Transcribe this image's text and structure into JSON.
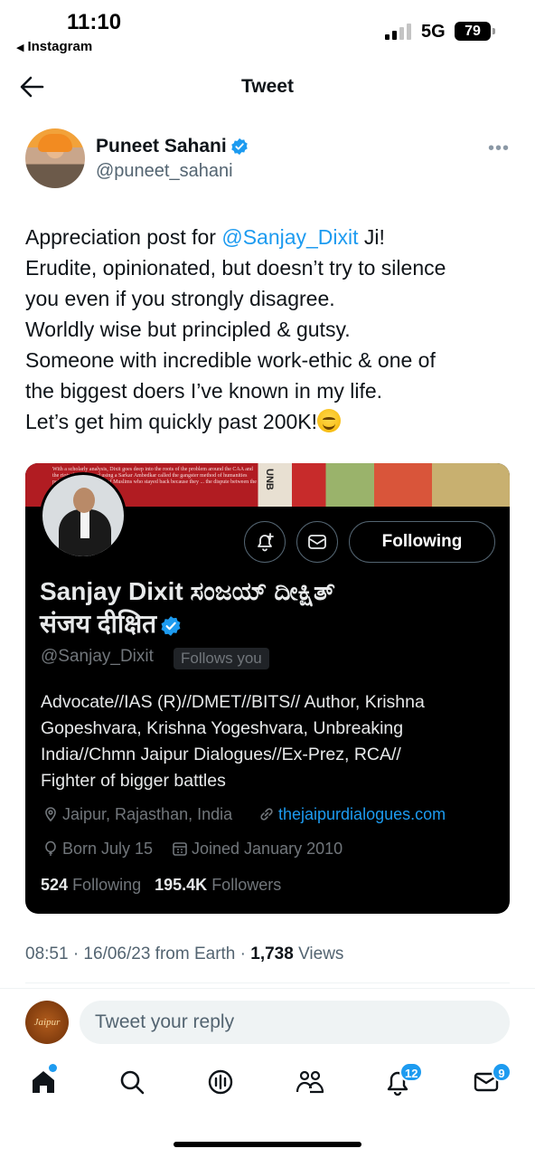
{
  "status_bar": {
    "time": "11:10",
    "back_app": "Instagram",
    "network": "5G",
    "battery": "79"
  },
  "header": {
    "title": "Tweet"
  },
  "author": {
    "name": "Puneet Sahani",
    "handle": "@puneet_sahani"
  },
  "tweet": {
    "prefix": "Appreciation post for ",
    "mention": "@Sanjay_Dixit",
    "suffix": " Ji!",
    "lines": [
      "Erudite, opinionated, but doesn’t try to silence",
      "you even if you strongly disagree.",
      "Worldly wise but principled & gutsy.",
      "Someone with incredible work-ethic & one of",
      "the biggest doers I’ve known in my life.",
      "Let’s get him quickly past 200K!"
    ]
  },
  "profile_card": {
    "banner_text": "With a scholarly analysis, Dixit goes deep into the roots of the problem around the CAA and the riots that followed using a Sarkar Ambedkar called the gangster method of humanities politically-correct myths of Muslims who stayed back because they ... the dispute between the Islamist",
    "banner_vertical": "UNB",
    "follow_label": "Following",
    "name_line1": "Sanjay Dixit ಸಂಜಯ್ ದೀಕ್ಷಿತ್",
    "name_line2": "संजय दीक्षित",
    "handle": "@Sanjay_Dixit",
    "follows_you": "Follows you",
    "bio_lines": [
      "Advocate//IAS (R)//DMET//BITS// Author, Krishna",
      "Gopeshvara, Krishna Yogeshvara, Unbreaking",
      "India//Chmn Jaipur Dialogues//Ex-Prez, RCA//",
      "Fighter of bigger battles"
    ],
    "location": "Jaipur, Rajasthan, India",
    "website": "thejaipurdialogues.com",
    "birthday": "Born July 15",
    "joined": "Joined January 2010",
    "following_count": "524",
    "following_label": "Following",
    "followers_count": "195.4K",
    "followers_label": "Followers"
  },
  "timestamp": {
    "text": "08:51 · 16/06/23 from Earth · ",
    "views_count": "1,738",
    "views_label": " Views"
  },
  "reply": {
    "avatar_text": "Jaipur",
    "placeholder": "Tweet your reply"
  },
  "tabbar": {
    "notifications_badge": "12",
    "messages_badge": "9"
  },
  "colors": {
    "accent": "#1d9bf0",
    "text": "#0f1419",
    "secondary": "#536471",
    "card_bg": "#000000"
  }
}
